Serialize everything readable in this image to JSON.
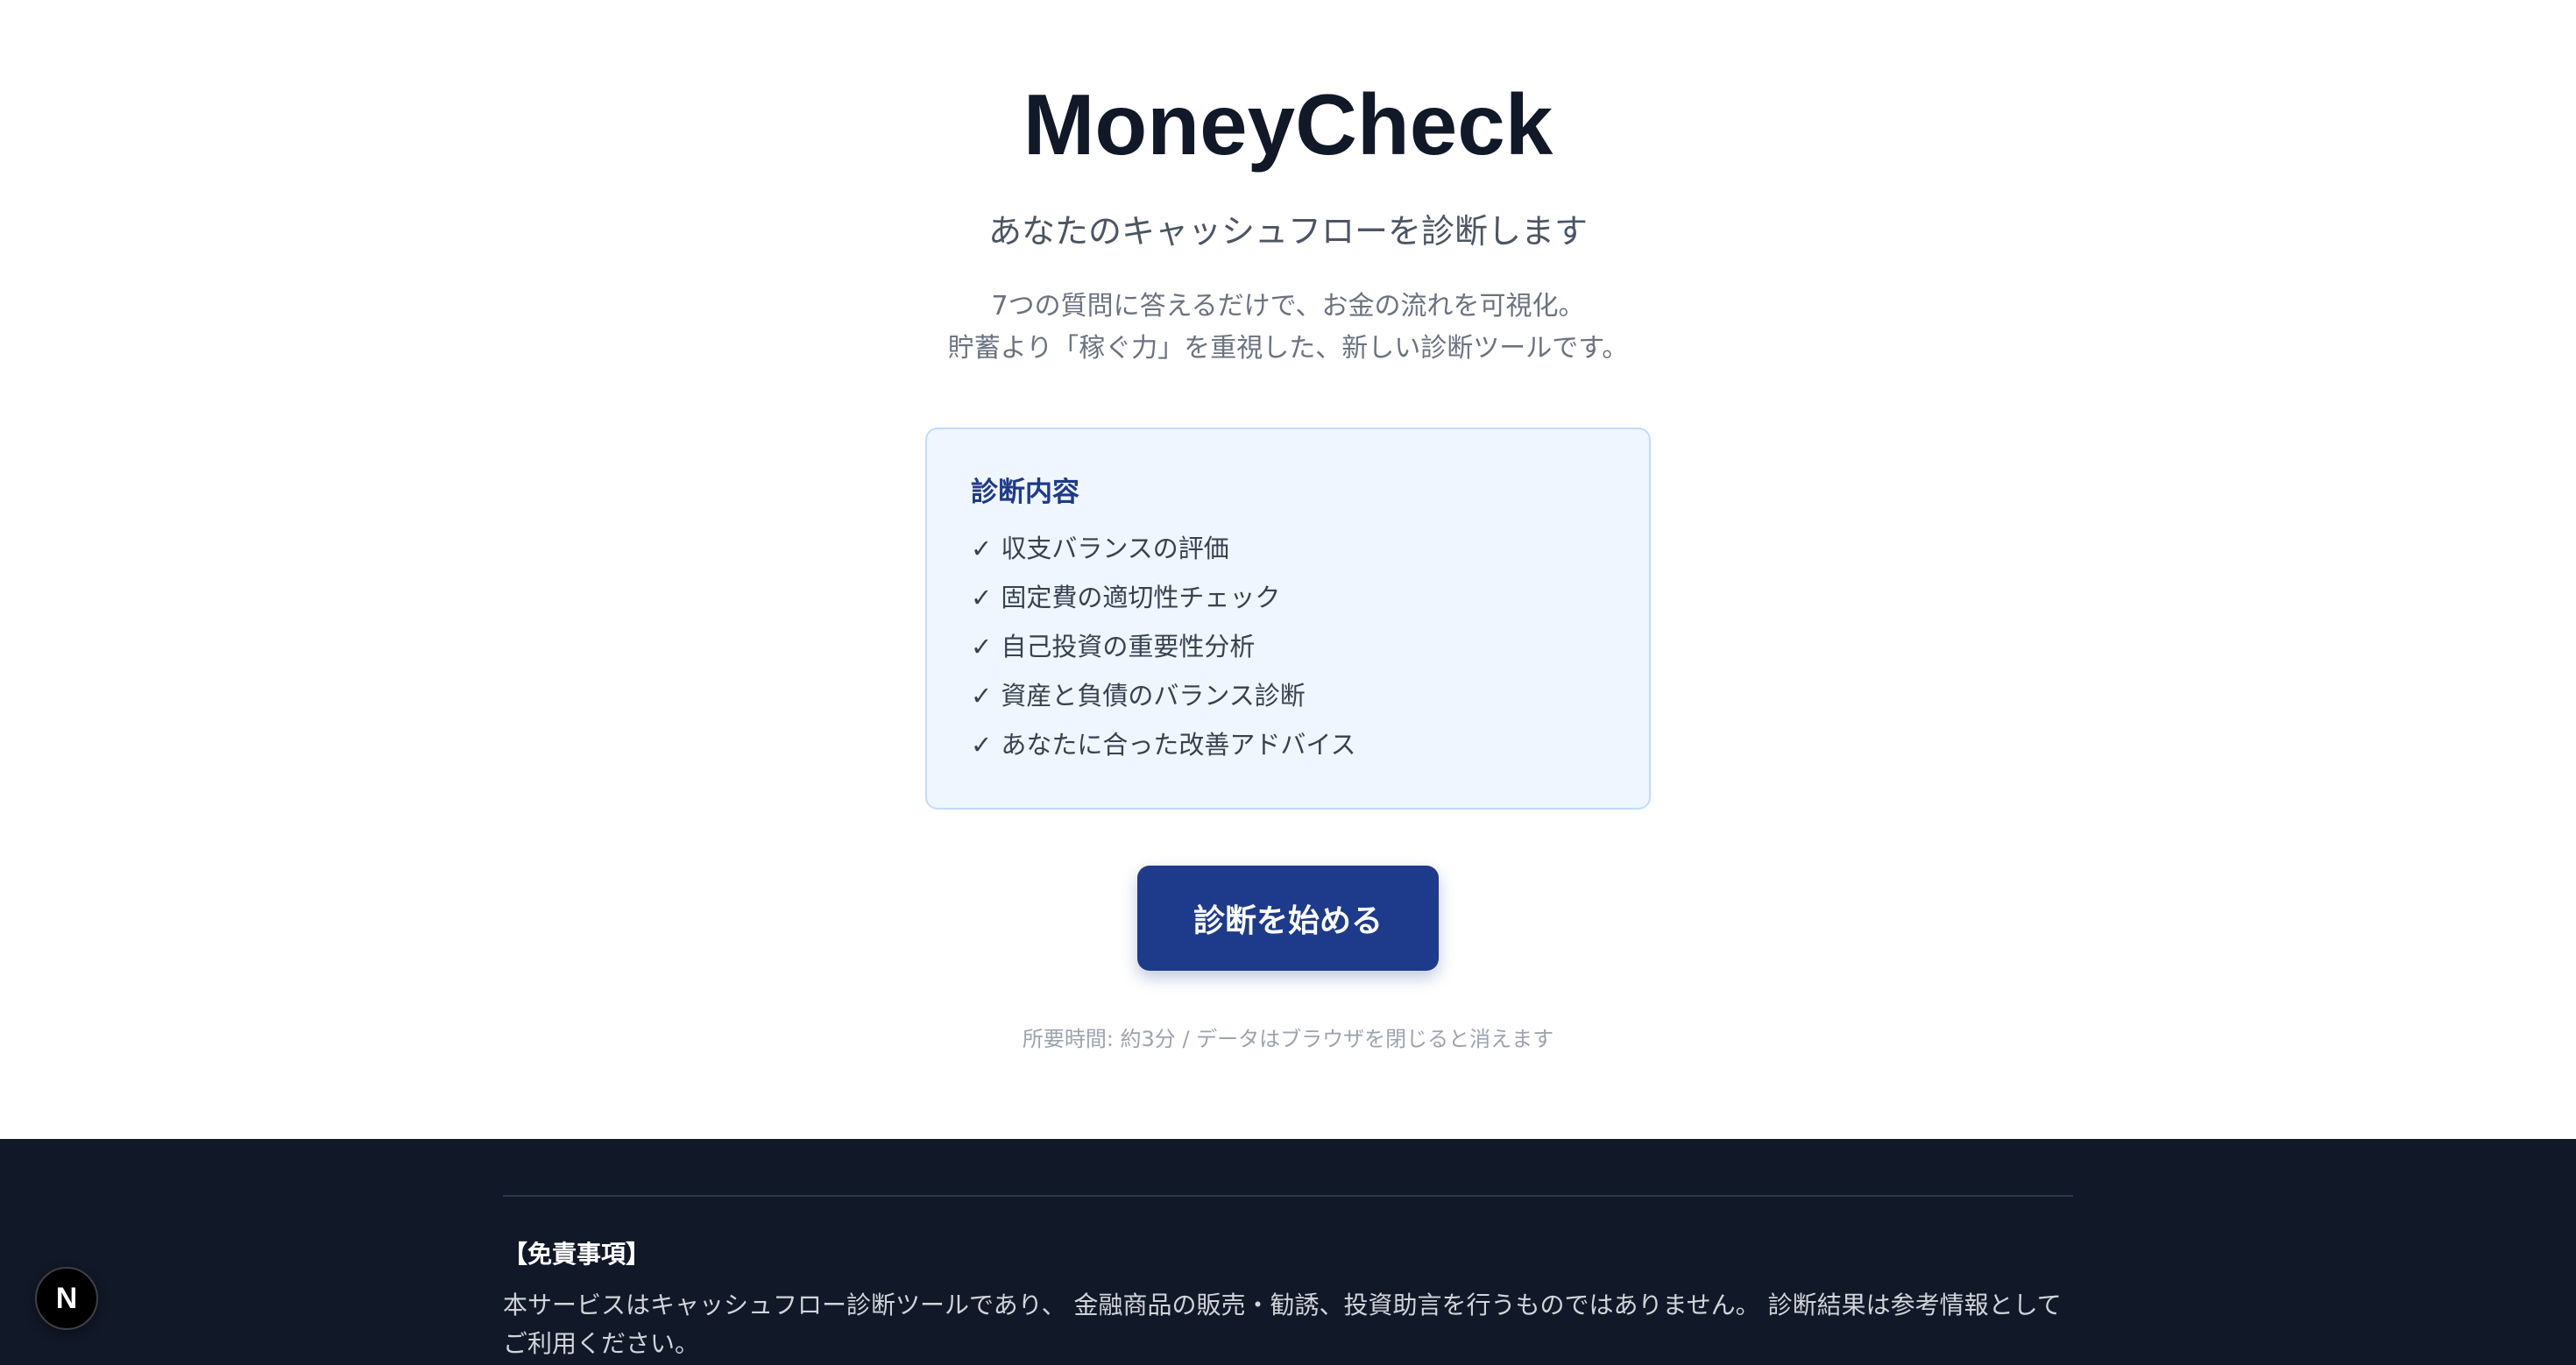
{
  "header": {
    "title": "MoneyCheck",
    "subtitle": "あなたのキャッシュフローを診断します",
    "description_lines": [
      "7つの質問に答えるだけで、お金の流れを可視化。",
      "貯蓄より「稼ぐ力」を重視した、新しい診断ツールです。"
    ]
  },
  "features": {
    "heading": "診断内容",
    "check_mark": "✓",
    "items": [
      "収支バランスの評価",
      "固定費の適切性チェック",
      "自己投資の重要性分析",
      "資産と負債のバランス診断",
      "あなたに合った改善アドバイス"
    ]
  },
  "cta": {
    "start_label": "診断を始める",
    "note": "所要時間: 約3分 / データはブラウザを閉じると消えます"
  },
  "footer": {
    "disclaimer_title": "【免責事項】",
    "disclaimer_text": "本サービスはキャッシュフロー診断ツールであり、 金融商品の販売・勧誘、投資助言を行うものではありません。 診断結果は参考情報としてご利用ください。"
  },
  "devtools": {
    "badge_label": "N"
  },
  "colors": {
    "title": "#111827",
    "accent": "#1e3a8a",
    "feature_bg": "#eff6ff",
    "feature_border": "#bfdbfe",
    "footer_bg": "#111827"
  },
  "icons": {
    "devtools": "nextjs-logo-icon"
  }
}
